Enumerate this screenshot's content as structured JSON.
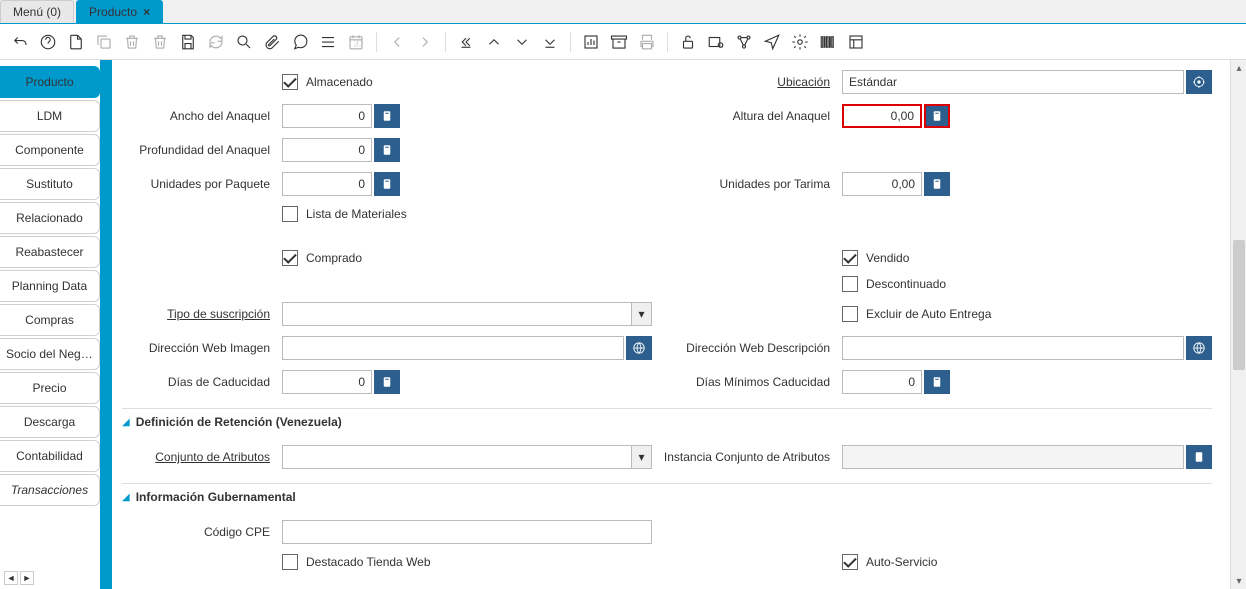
{
  "tabs": {
    "menu": "Menú (0)",
    "producto": "Producto"
  },
  "sidebar": {
    "items": [
      {
        "label": "Producto",
        "active": true
      },
      {
        "label": "LDM"
      },
      {
        "label": "Componente",
        "disabled": true
      },
      {
        "label": "Sustituto"
      },
      {
        "label": "Relacionado"
      },
      {
        "label": "Reabastecer"
      },
      {
        "label": "Planning Data"
      },
      {
        "label": "Compras"
      },
      {
        "label": "Socio del Negocio"
      },
      {
        "label": "Precio"
      },
      {
        "label": "Descarga"
      },
      {
        "label": "Contabilidad"
      },
      {
        "label": "Transacciones",
        "italic": true
      }
    ]
  },
  "form": {
    "almacenado_label": "Almacenado",
    "ubicacion_label": "Ubicación",
    "ubicacion_value": "Estándar",
    "ancho_anaquel_label": "Ancho del Anaquel",
    "ancho_anaquel_value": "0",
    "altura_anaquel_label": "Altura del Anaquel",
    "altura_anaquel_value": "0,00",
    "profundidad_anaquel_label": "Profundidad del Anaquel",
    "profundidad_anaquel_value": "0",
    "unidades_paquete_label": "Unidades por Paquete",
    "unidades_paquete_value": "0",
    "unidades_tarima_label": "Unidades por Tarima",
    "unidades_tarima_value": "0,00",
    "lista_materiales_label": "Lista de Materiales",
    "comprado_label": "Comprado",
    "vendido_label": "Vendido",
    "descontinuado_label": "Descontinuado",
    "tipo_suscripcion_label": "Tipo de suscripción",
    "excluir_auto_entrega_label": "Excluir de Auto Entrega",
    "direccion_web_imagen_label": "Dirección Web Imagen",
    "direccion_web_descripcion_label": "Dirección Web Descripción",
    "dias_caducidad_label": "Días de Caducidad",
    "dias_caducidad_value": "0",
    "dias_minimos_caducidad_label": "Días Mínimos Caducidad",
    "dias_minimos_caducidad_value": "0",
    "section1": "Definición de Retención (Venezuela)",
    "conjunto_atributos_label": "Conjunto de Atributos",
    "instancia_conjunto_atributos_label": "Instancia Conjunto de Atributos",
    "section2": "Información Gubernamental",
    "codigo_cpe_label": "Código CPE",
    "destacado_tienda_web_label": "Destacado Tienda Web",
    "auto_servicio_label": "Auto-Servicio"
  }
}
